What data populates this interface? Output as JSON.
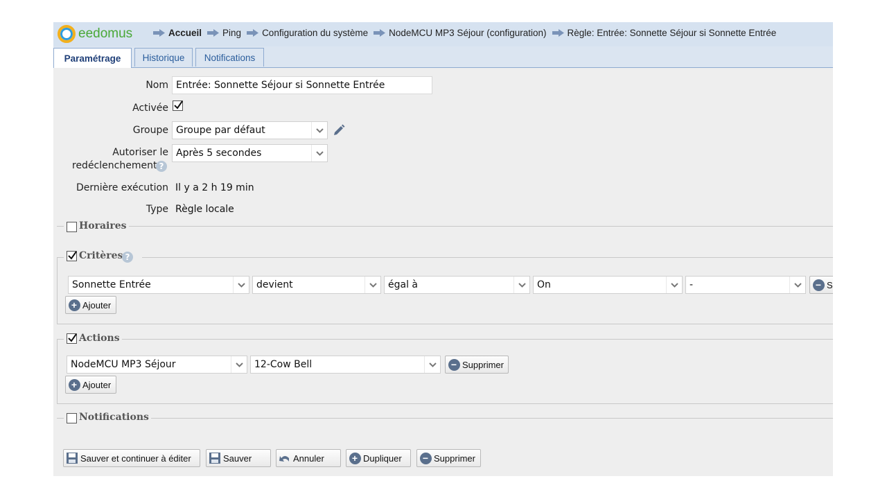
{
  "app": {
    "logo_text": "eedomus"
  },
  "breadcrumbs": [
    {
      "label": "Accueil"
    },
    {
      "label": "Ping"
    },
    {
      "label": "Configuration du système"
    },
    {
      "label": "NodeMCU MP3 Séjour (configuration)"
    },
    {
      "label": "Règle: Entrée: Sonnette Séjour si Sonnette Entrée"
    }
  ],
  "tabs": [
    {
      "label": "Paramétrage",
      "active": true
    },
    {
      "label": "Historique",
      "active": false
    },
    {
      "label": "Notifications",
      "active": false
    }
  ],
  "form": {
    "nom_label": "Nom",
    "nom_value": "Entrée: Sonnette Séjour si Sonnette Entrée",
    "activee_label": "Activée",
    "activee_checked": true,
    "groupe_label": "Groupe",
    "groupe_value": "Groupe par défaut",
    "autoriser_label_1": "Autoriser le",
    "autoriser_label_2": "redéclenchement",
    "autoriser_value": "Après 5 secondes",
    "derniere_label": "Dernière exécution",
    "derniere_value": "Il y a 2 h 19 min",
    "type_label": "Type",
    "type_value": "Règle locale"
  },
  "sections": {
    "horaires": {
      "title": "Horaires",
      "checked": false
    },
    "criteres": {
      "title": "Critères",
      "checked": true,
      "row": {
        "device": "Sonnette Entrée",
        "event": "devient",
        "comparator": "égal à",
        "value": "On",
        "extra": "-",
        "delete_label": "S"
      },
      "add_label": "Ajouter"
    },
    "actions": {
      "title": "Actions",
      "checked": true,
      "row": {
        "device": "NodeMCU MP3 Séjour",
        "action": "12-Cow Bell",
        "delete_label": "Supprimer"
      },
      "add_label": "Ajouter"
    },
    "notifications": {
      "title": "Notifications",
      "checked": false
    }
  },
  "footer": {
    "save_continue": "Sauver et continuer à éditer",
    "save": "Sauver",
    "cancel": "Annuler",
    "duplicate": "Dupliquer",
    "delete": "Supprimer"
  },
  "colors": {
    "accent": "#2a5d9c",
    "topbar": "#d6e2f0",
    "logo_green": "#49a837"
  }
}
